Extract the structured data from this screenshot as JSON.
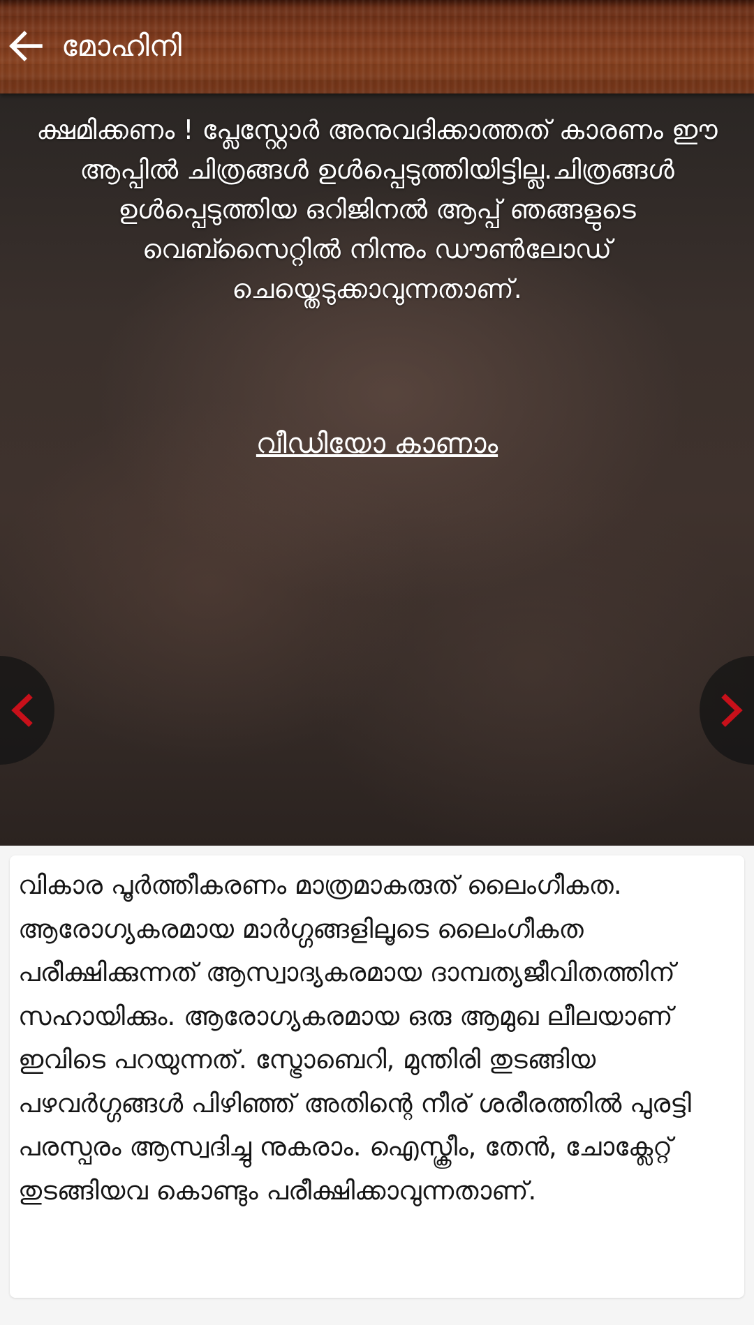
{
  "app_bar": {
    "title": "മോഹിനി",
    "back_icon": "arrow-left-icon"
  },
  "image_viewer": {
    "notice": "ക്ഷമിക്കണം ! പ്ലേസ്റ്റോർ അനുവദിക്കാത്തത് കാരണം ഈ ആപ്പിൽ ചിത്രങ്ങൾ ഉൾപ്പെടുത്തിയിട്ടില്ല.ചിത്രങ്ങൾ ഉൾപ്പെടുത്തിയ ഒറിജിനൽ ആപ്പ് ഞങ്ങളുടെ വെബ്സൈറ്റിൽ നിന്നും ഡൗൺലോഡ് ചെയ്തെടുക്കാവുന്നതാണ്.",
    "video_link": "വീഡിയോ കാണാം",
    "prev_icon": "chevron-left-icon",
    "next_icon": "chevron-right-icon",
    "arrow_color": "#c8101a"
  },
  "description": {
    "text": "വികാര പൂർത്തീകരണം മാത്രമാകരുത് ലൈംഗീകത. ആരോഗ്യകരമായ മാർഗ്ഗങ്ങളിലൂടെ ലൈംഗീകത പരീക്ഷിക്കുന്നത് ആസ്വാദ്യകരമായ ദാമ്പത്യജീവിതത്തിന് സഹായിക്കും. ആരോഗ്യകരമായ ഒരു ആമുഖ ലീലയാണ് ഇവിടെ പറയുന്നത്. സ്ട്രോബെറി, മുന്തിരി തുടങ്ങിയ പഴവർഗ്ഗങ്ങൾ പിഴിഞ്ഞ് അതിന്റെ നീര് ശരീരത്തിൽ പുരട്ടി പരസ്പരം ആസ്വദിച്ചു നുകരാം. ഐസ്ക്രീം, തേൻ, ചോക്ലേറ്റ് തുടങ്ങിയവ കൊണ്ടും പരീക്ഷിക്കാവുന്നതാണ്."
  }
}
